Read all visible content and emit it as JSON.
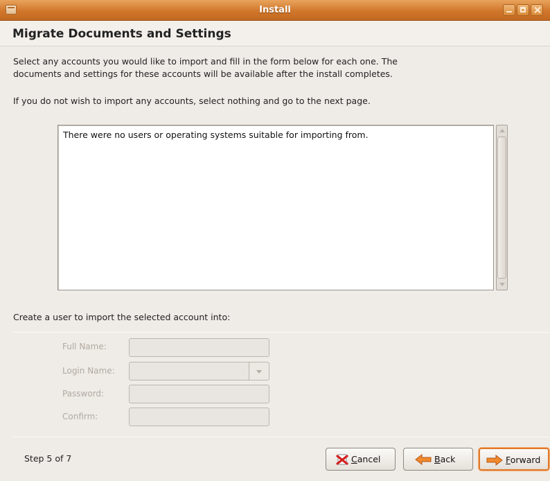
{
  "window": {
    "title": "Install"
  },
  "page": {
    "heading": "Migrate Documents and Settings",
    "intro_line1": "Select any accounts you would like to import and fill in the form below for each one.  The",
    "intro_line2": "documents and settings for these accounts will be available after the install completes.",
    "skip_note": "If you do not wish to import any accounts, select nothing and go to the next page."
  },
  "accounts_list": {
    "empty_message": "There were no users or operating systems suitable for importing from."
  },
  "user_form": {
    "label": "Create a user to import the selected account into:",
    "full_name_label": "Full Name:",
    "full_name_value": "",
    "login_name_label": "Login Name:",
    "login_name_value": "",
    "password_label": "Password:",
    "password_value": "",
    "confirm_label": "Confirm:",
    "confirm_value": ""
  },
  "footer": {
    "step_text": "Step 5 of 7",
    "cancel_label_mnemonic": "C",
    "cancel_label_rest": "ancel",
    "back_label_mnemonic": "B",
    "back_label_rest": "ack",
    "forward_label_mnemonic": "F",
    "forward_label_rest": "orward"
  },
  "colors": {
    "titlebar": "#d1772b",
    "accent": "#e0782a",
    "window_bg": "#efebe7"
  },
  "icons": {
    "cancel": "red-x-icon",
    "back": "left-arrow-icon",
    "forward": "right-arrow-icon"
  }
}
